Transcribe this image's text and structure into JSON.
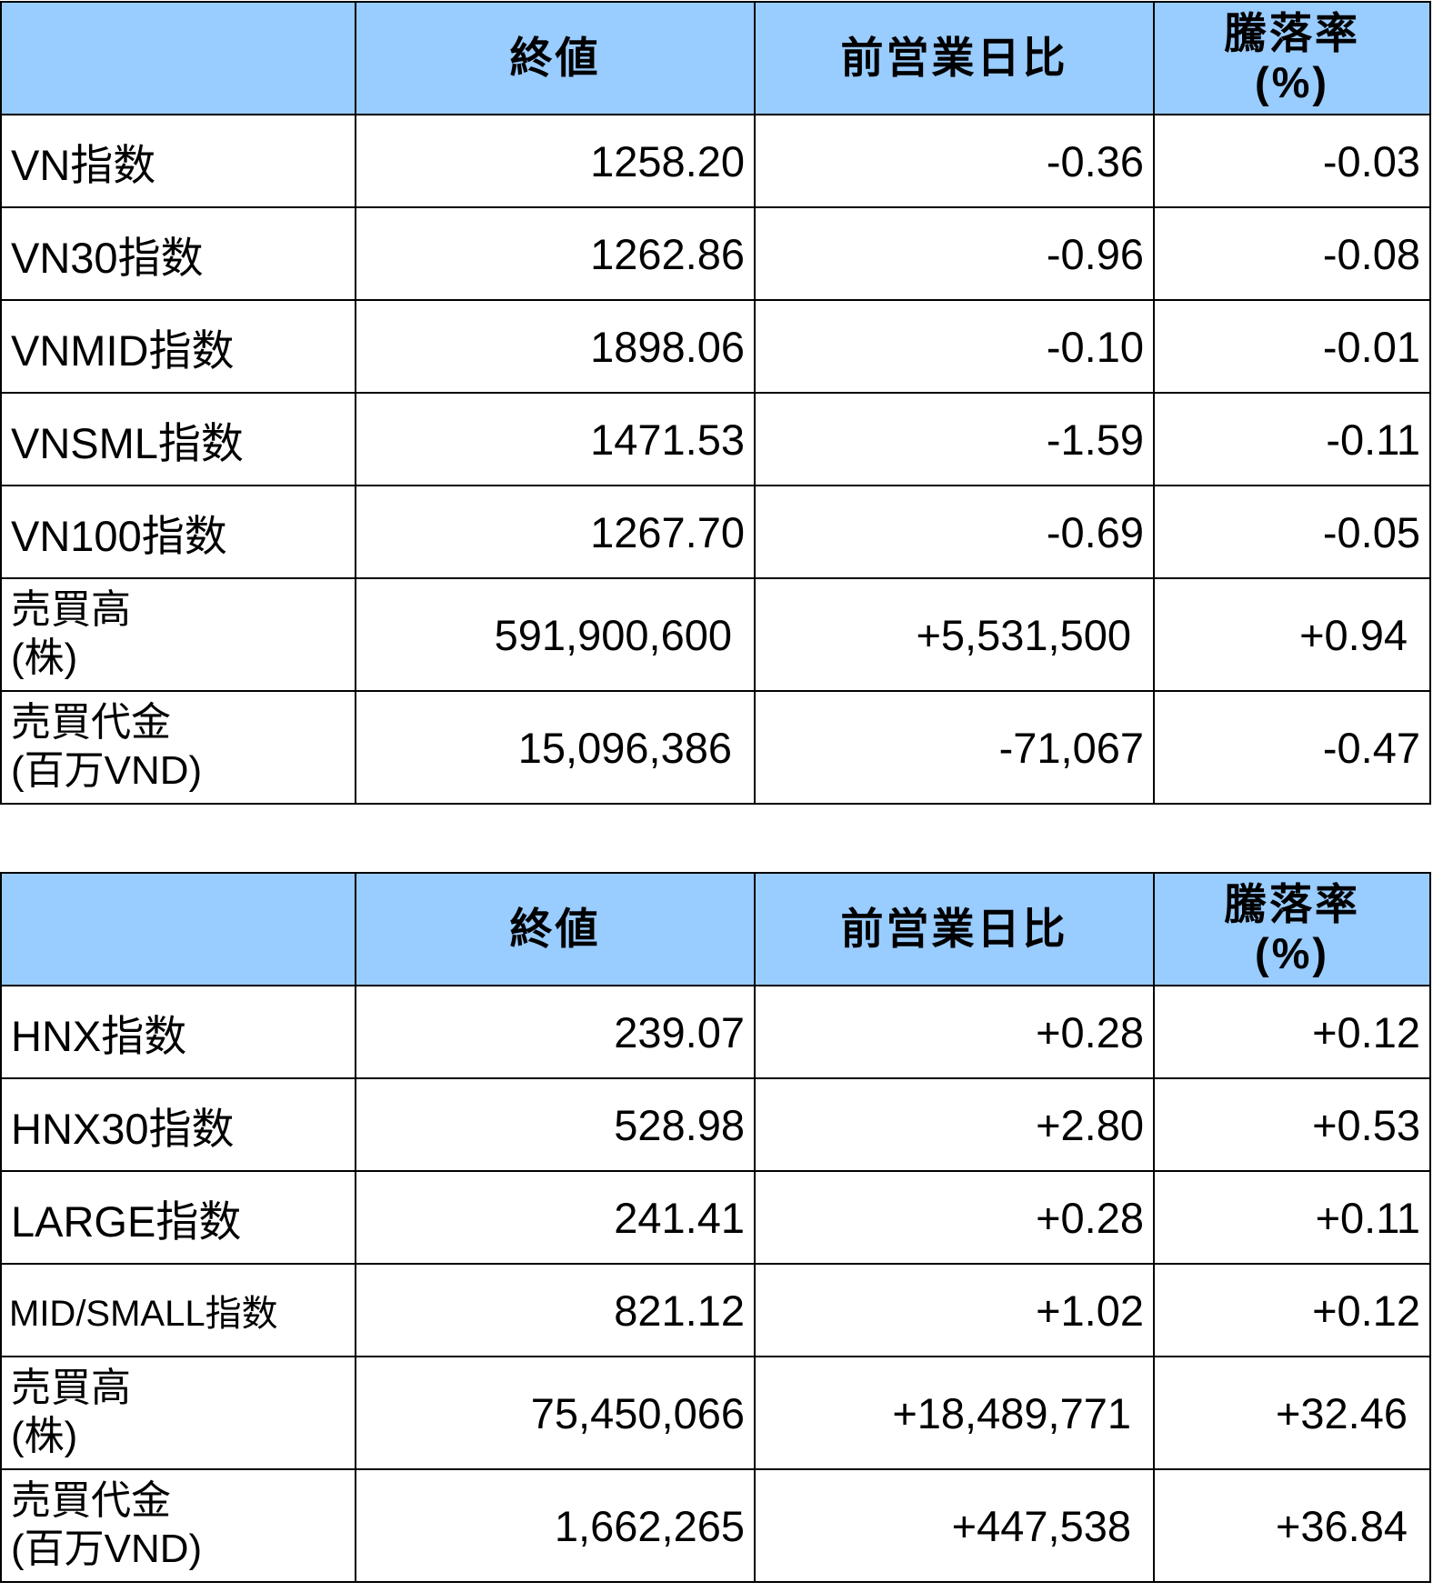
{
  "header": {
    "blank": "",
    "close": "終値",
    "change": "前営業日比",
    "rate_line1": "騰落率",
    "rate_line2": "(%)"
  },
  "table1": {
    "rows": [
      {
        "label": "VN指数",
        "close": "1258.20",
        "change": "-0.36",
        "rate": "-0.03"
      },
      {
        "label": "VN30指数",
        "close": "1262.86",
        "change": "-0.96",
        "rate": "-0.08"
      },
      {
        "label": "VNMID指数",
        "close": "1898.06",
        "change": "-0.10",
        "rate": "-0.01"
      },
      {
        "label": "VNSML指数",
        "close": "1471.53",
        "change": "-1.59",
        "rate": "-0.11"
      },
      {
        "label": "VN100指数",
        "close": "1267.70",
        "change": "-0.69",
        "rate": "-0.05"
      }
    ],
    "volume": {
      "label_line1": "売買高",
      "label_line2": "(株)",
      "close": "591,900,600",
      "change": "+5,531,500",
      "rate": "+0.94"
    },
    "value": {
      "label_line1": "売買代金",
      "label_line2": "(百万VND)",
      "close": "15,096,386",
      "change": "-71,067",
      "rate": "-0.47"
    }
  },
  "table2": {
    "rows": [
      {
        "label": "HNX指数",
        "close": "239.07",
        "change": "+0.28",
        "rate": "+0.12"
      },
      {
        "label": "HNX30指数",
        "close": "528.98",
        "change": "+2.80",
        "rate": "+0.53"
      },
      {
        "label": "LARGE指数",
        "close": "241.41",
        "change": "+0.28",
        "rate": "+0.11"
      },
      {
        "label": "MID/SMALL指数",
        "close": "821.12",
        "change": "+1.02",
        "rate": "+0.12"
      }
    ],
    "volume": {
      "label_line1": "売買高",
      "label_line2": "(株)",
      "close": "75,450,066",
      "change": "+18,489,771",
      "rate": "+32.46"
    },
    "value": {
      "label_line1": "売買代金",
      "label_line2": "(百万VND)",
      "close": "1,662,265",
      "change": "+447,538",
      "rate": "+36.84"
    }
  },
  "colors": {
    "header_bg": "#99ccff",
    "border": "#000000",
    "text": "#000000"
  }
}
